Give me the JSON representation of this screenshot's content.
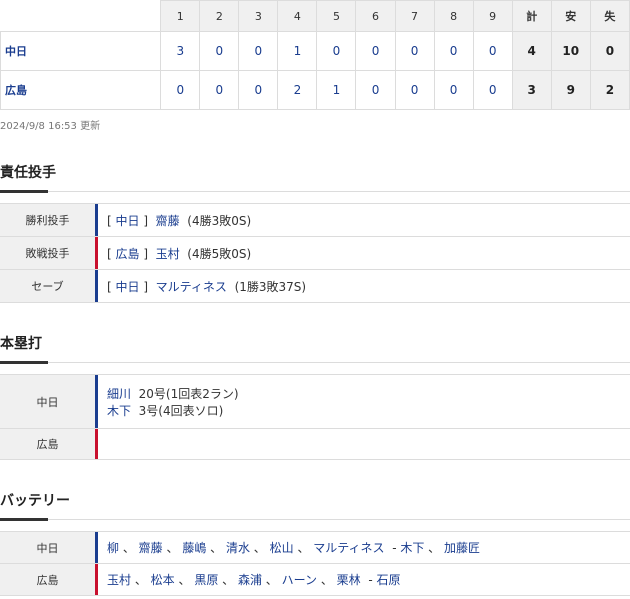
{
  "scoreboard": {
    "headers": [
      "1",
      "2",
      "3",
      "4",
      "5",
      "6",
      "7",
      "8",
      "9",
      "計",
      "安",
      "失"
    ],
    "rows": [
      {
        "team": "中日",
        "innings": [
          "3",
          "0",
          "0",
          "1",
          "0",
          "0",
          "0",
          "0",
          "0"
        ],
        "runs": "4",
        "hits": "10",
        "errors": "0"
      },
      {
        "team": "広島",
        "innings": [
          "0",
          "0",
          "0",
          "2",
          "1",
          "0",
          "0",
          "0",
          "0"
        ],
        "runs": "3",
        "hits": "9",
        "errors": "2"
      }
    ]
  },
  "updated": "2024/9/8 16:53 更新",
  "pitchers": {
    "title": "責任投手",
    "rows": [
      {
        "label": "勝利投手",
        "team": "中日",
        "name": "齋藤",
        "record": "(4勝3敗0S)",
        "color": "#1a3d8f"
      },
      {
        "label": "敗戦投手",
        "team": "広島",
        "name": "玉村",
        "record": "(4勝5敗0S)",
        "color": "#c8102e"
      },
      {
        "label": "セーブ",
        "team": "中日",
        "name": "マルティネス",
        "record": "(1勝3敗37S)",
        "color": "#1a3d8f"
      }
    ]
  },
  "homeruns": {
    "title": "本塁打",
    "rows": [
      {
        "label": "中日",
        "entries": [
          {
            "name": "細川",
            "detail": "20号(1回表2ラン)"
          },
          {
            "name": "木下",
            "detail": "3号(4回表ソロ)"
          }
        ]
      },
      {
        "label": "広島",
        "entries": []
      }
    ]
  },
  "battery": {
    "title": "バッテリー",
    "rows": [
      {
        "label": "中日",
        "pitchers": [
          "柳",
          "齋藤",
          "藤嶋",
          "清水",
          "松山",
          "マルティネス"
        ],
        "catchers": [
          "木下",
          "加藤匠"
        ]
      },
      {
        "label": "広島",
        "pitchers": [
          "玉村",
          "松本",
          "黒原",
          "森浦",
          "ハーン",
          "栗林"
        ],
        "catchers": [
          "石原"
        ]
      }
    ]
  }
}
